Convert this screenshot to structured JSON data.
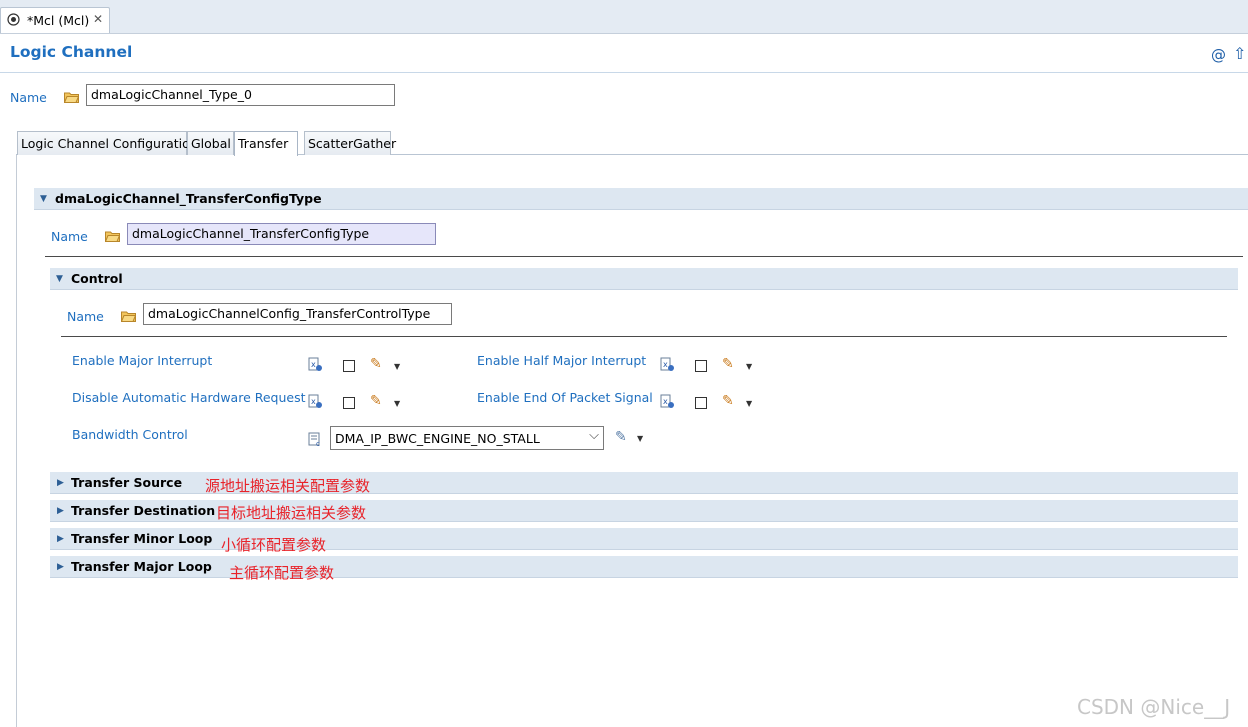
{
  "editor_tab": {
    "label": "*Mcl (Mcl)",
    "close_icon": "close-icon",
    "icon": "module-icon"
  },
  "header": {
    "title": "Logic Channel",
    "help_icon": "at-icon",
    "up_icon": "up-arrow-icon"
  },
  "name_field": {
    "label": "Name",
    "value": "dmaLogicChannel_Type_0"
  },
  "tabs": [
    {
      "label": "Logic Channel Configuration"
    },
    {
      "label": "Global"
    },
    {
      "label": "Transfer"
    },
    {
      "label": "ScatterGather"
    }
  ],
  "transfer_config": {
    "title": "dmaLogicChannel_TransferConfigType",
    "name_label": "Name",
    "name_value": "dmaLogicChannel_TransferConfigType",
    "control": {
      "title": "Control",
      "name_label": "Name",
      "name_value": "dmaLogicChannelConfig_TransferControlType",
      "params": {
        "enable_major_interrupt": "Enable Major Interrupt",
        "enable_half_major_interrupt": "Enable Half Major Interrupt",
        "disable_automatic_hw_request": "Disable Automatic Hardware Request",
        "enable_end_of_packet_signal": "Enable End Of Packet Signal",
        "bandwidth_control": "Bandwidth Control"
      },
      "bandwidth_value": "DMA_IP_BWC_ENGINE_NO_STALL",
      "checkboxes": {
        "enable_major_interrupt": false,
        "enable_half_major_interrupt": false,
        "disable_automatic_hw_request": false,
        "enable_end_of_packet_signal": false
      }
    },
    "sections": [
      {
        "title": "Transfer Source",
        "annotation": "源地址搬运相关配置参数"
      },
      {
        "title": "Transfer Destination",
        "annotation": "目标地址搬运相关参数"
      },
      {
        "title": "Transfer Minor Loop",
        "annotation": "小循环配置参数"
      },
      {
        "title": "Transfer Major Loop",
        "annotation": "主循环配置参数"
      }
    ]
  },
  "watermark": "CSDN @Nice__J",
  "colors": {
    "label_blue": "#1f6fbf",
    "annotation_red": "#e8232a",
    "section_bg": "#dde7f1"
  }
}
